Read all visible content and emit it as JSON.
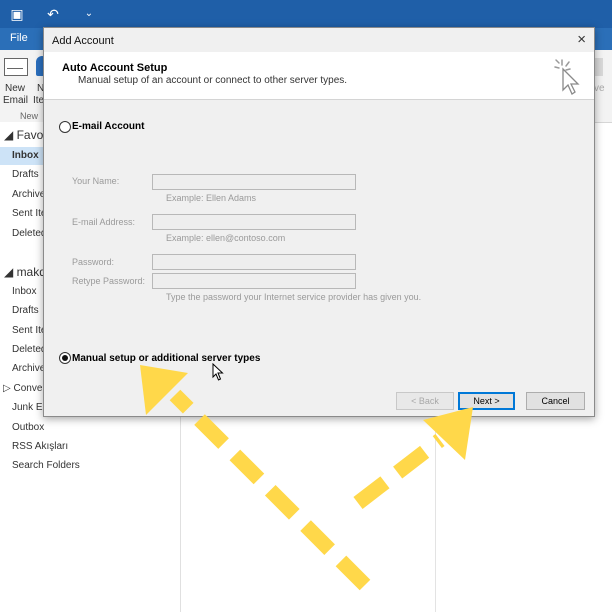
{
  "outlook": {
    "menu_file": "File",
    "ribbon": {
      "new_email_line1": "New",
      "new_email_line2": "Email",
      "new_items_line1": "N",
      "new_items_line2": "Ite",
      "group_new": "New",
      "partial_right": "ve"
    },
    "favorites_header": "Favori",
    "favorites": [
      "Inbox",
      "Drafts",
      "Archive",
      "Sent Ite",
      "Deleted"
    ],
    "account_header": "makd",
    "folders": [
      "Inbox",
      "Drafts",
      "Sent Ite",
      "Deleted",
      "Archive",
      "Conver",
      "Junk Er",
      "Outbox",
      "RSS Akışları",
      "Search Folders"
    ]
  },
  "dialog": {
    "title": "Add Account",
    "close_glyph": "×",
    "header_title": "Auto Account Setup",
    "header_subtitle": "Manual setup of an account or connect to other server types.",
    "email_account_label": "E-mail Account",
    "your_name_label": "Your Name:",
    "your_name_example": "Example: Ellen Adams",
    "email_address_label": "E-mail Address:",
    "email_address_example": "Example: ellen@contoso.com",
    "password_label": "Password:",
    "retype_password_label": "Retype Password:",
    "password_hint": "Type the password your Internet service provider has given you.",
    "manual_setup_label": "Manual setup or additional server types",
    "back_button": "< Back",
    "next_button": "Next >",
    "cancel_button": "Cancel"
  },
  "colors": {
    "titlebar": "#1f5fa8",
    "annotation_arrow": "#ffd84a",
    "default_button_border": "#0078d7"
  }
}
